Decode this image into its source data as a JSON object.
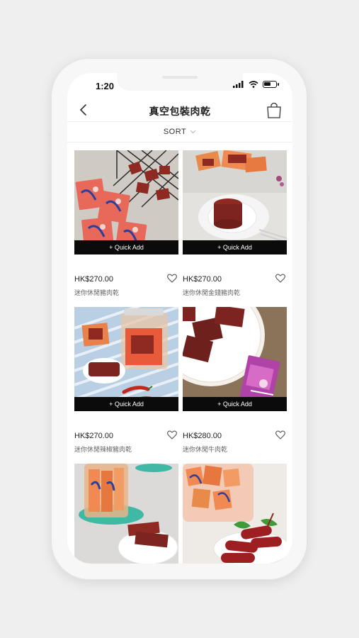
{
  "status_bar": {
    "time": "1:20"
  },
  "header": {
    "title": "真空包裝肉乾",
    "back_icon": "chevron-left-icon",
    "cart_icon": "shopping-bag-icon"
  },
  "sort": {
    "label": "SORT",
    "icon": "chevron-down-icon"
  },
  "products": [
    {
      "price": "HK$270.00",
      "name": "迷你休閒豬肉乾",
      "quick_add": "+ Quick Add"
    },
    {
      "price": "HK$270.00",
      "name": "迷你休閒金錢豬肉乾",
      "quick_add": "+ Quick Add"
    },
    {
      "price": "HK$270.00",
      "name": "迷你休閒辣椒豬肉乾",
      "quick_add": "+ Quick Add"
    },
    {
      "price": "HK$280.00",
      "name": "迷你休閒牛肉乾",
      "quick_add": "+ Quick Add"
    },
    {
      "price": "",
      "name": "",
      "quick_add": ""
    },
    {
      "price": "",
      "name": "",
      "quick_add": ""
    }
  ],
  "colors": {
    "accent": "#0b0b0b",
    "background": "#efefef",
    "meat": "#8e2a22"
  }
}
